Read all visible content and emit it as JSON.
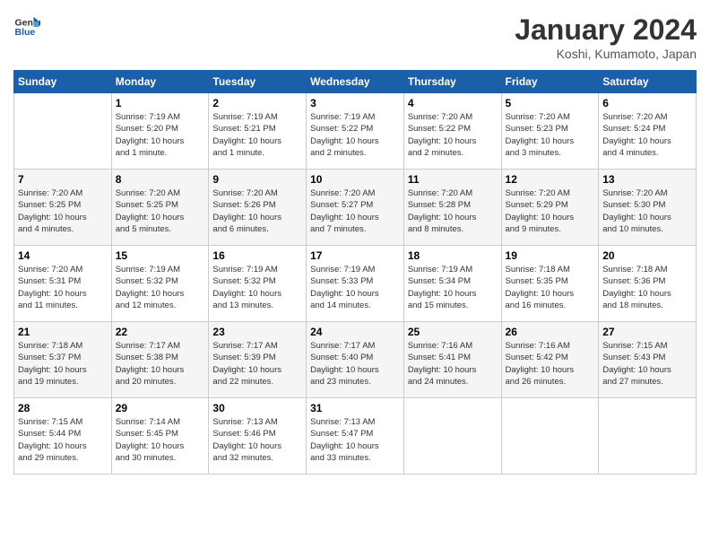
{
  "header": {
    "logo_line1": "General",
    "logo_line2": "Blue",
    "title": "January 2024",
    "location": "Koshi, Kumamoto, Japan"
  },
  "days_of_week": [
    "Sunday",
    "Monday",
    "Tuesday",
    "Wednesday",
    "Thursday",
    "Friday",
    "Saturday"
  ],
  "weeks": [
    [
      {
        "day": "",
        "info": ""
      },
      {
        "day": "1",
        "info": "Sunrise: 7:19 AM\nSunset: 5:20 PM\nDaylight: 10 hours\nand 1 minute."
      },
      {
        "day": "2",
        "info": "Sunrise: 7:19 AM\nSunset: 5:21 PM\nDaylight: 10 hours\nand 1 minute."
      },
      {
        "day": "3",
        "info": "Sunrise: 7:19 AM\nSunset: 5:22 PM\nDaylight: 10 hours\nand 2 minutes."
      },
      {
        "day": "4",
        "info": "Sunrise: 7:20 AM\nSunset: 5:22 PM\nDaylight: 10 hours\nand 2 minutes."
      },
      {
        "day": "5",
        "info": "Sunrise: 7:20 AM\nSunset: 5:23 PM\nDaylight: 10 hours\nand 3 minutes."
      },
      {
        "day": "6",
        "info": "Sunrise: 7:20 AM\nSunset: 5:24 PM\nDaylight: 10 hours\nand 4 minutes."
      }
    ],
    [
      {
        "day": "7",
        "info": "Sunrise: 7:20 AM\nSunset: 5:25 PM\nDaylight: 10 hours\nand 4 minutes."
      },
      {
        "day": "8",
        "info": "Sunrise: 7:20 AM\nSunset: 5:25 PM\nDaylight: 10 hours\nand 5 minutes."
      },
      {
        "day": "9",
        "info": "Sunrise: 7:20 AM\nSunset: 5:26 PM\nDaylight: 10 hours\nand 6 minutes."
      },
      {
        "day": "10",
        "info": "Sunrise: 7:20 AM\nSunset: 5:27 PM\nDaylight: 10 hours\nand 7 minutes."
      },
      {
        "day": "11",
        "info": "Sunrise: 7:20 AM\nSunset: 5:28 PM\nDaylight: 10 hours\nand 8 minutes."
      },
      {
        "day": "12",
        "info": "Sunrise: 7:20 AM\nSunset: 5:29 PM\nDaylight: 10 hours\nand 9 minutes."
      },
      {
        "day": "13",
        "info": "Sunrise: 7:20 AM\nSunset: 5:30 PM\nDaylight: 10 hours\nand 10 minutes."
      }
    ],
    [
      {
        "day": "14",
        "info": "Sunrise: 7:20 AM\nSunset: 5:31 PM\nDaylight: 10 hours\nand 11 minutes."
      },
      {
        "day": "15",
        "info": "Sunrise: 7:19 AM\nSunset: 5:32 PM\nDaylight: 10 hours\nand 12 minutes."
      },
      {
        "day": "16",
        "info": "Sunrise: 7:19 AM\nSunset: 5:32 PM\nDaylight: 10 hours\nand 13 minutes."
      },
      {
        "day": "17",
        "info": "Sunrise: 7:19 AM\nSunset: 5:33 PM\nDaylight: 10 hours\nand 14 minutes."
      },
      {
        "day": "18",
        "info": "Sunrise: 7:19 AM\nSunset: 5:34 PM\nDaylight: 10 hours\nand 15 minutes."
      },
      {
        "day": "19",
        "info": "Sunrise: 7:18 AM\nSunset: 5:35 PM\nDaylight: 10 hours\nand 16 minutes."
      },
      {
        "day": "20",
        "info": "Sunrise: 7:18 AM\nSunset: 5:36 PM\nDaylight: 10 hours\nand 18 minutes."
      }
    ],
    [
      {
        "day": "21",
        "info": "Sunrise: 7:18 AM\nSunset: 5:37 PM\nDaylight: 10 hours\nand 19 minutes."
      },
      {
        "day": "22",
        "info": "Sunrise: 7:17 AM\nSunset: 5:38 PM\nDaylight: 10 hours\nand 20 minutes."
      },
      {
        "day": "23",
        "info": "Sunrise: 7:17 AM\nSunset: 5:39 PM\nDaylight: 10 hours\nand 22 minutes."
      },
      {
        "day": "24",
        "info": "Sunrise: 7:17 AM\nSunset: 5:40 PM\nDaylight: 10 hours\nand 23 minutes."
      },
      {
        "day": "25",
        "info": "Sunrise: 7:16 AM\nSunset: 5:41 PM\nDaylight: 10 hours\nand 24 minutes."
      },
      {
        "day": "26",
        "info": "Sunrise: 7:16 AM\nSunset: 5:42 PM\nDaylight: 10 hours\nand 26 minutes."
      },
      {
        "day": "27",
        "info": "Sunrise: 7:15 AM\nSunset: 5:43 PM\nDaylight: 10 hours\nand 27 minutes."
      }
    ],
    [
      {
        "day": "28",
        "info": "Sunrise: 7:15 AM\nSunset: 5:44 PM\nDaylight: 10 hours\nand 29 minutes."
      },
      {
        "day": "29",
        "info": "Sunrise: 7:14 AM\nSunset: 5:45 PM\nDaylight: 10 hours\nand 30 minutes."
      },
      {
        "day": "30",
        "info": "Sunrise: 7:13 AM\nSunset: 5:46 PM\nDaylight: 10 hours\nand 32 minutes."
      },
      {
        "day": "31",
        "info": "Sunrise: 7:13 AM\nSunset: 5:47 PM\nDaylight: 10 hours\nand 33 minutes."
      },
      {
        "day": "",
        "info": ""
      },
      {
        "day": "",
        "info": ""
      },
      {
        "day": "",
        "info": ""
      }
    ]
  ]
}
